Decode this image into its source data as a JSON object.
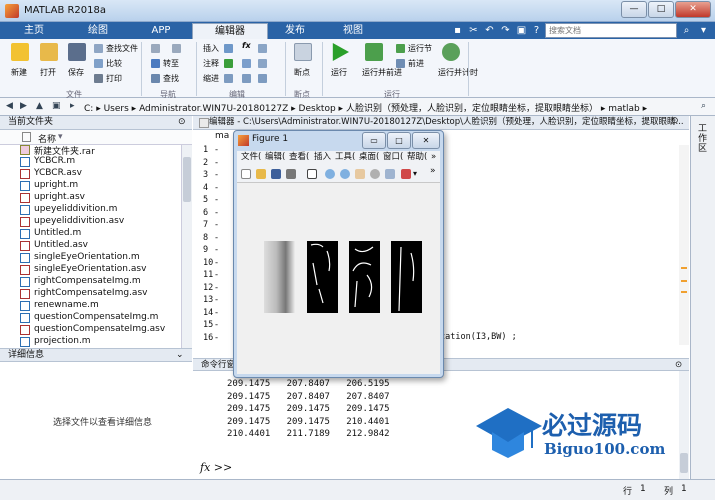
{
  "window": {
    "title": "MATLAB R2018a",
    "min": "—",
    "max": "□",
    "close": "✕"
  },
  "tabs": [
    {
      "label": "主页"
    },
    {
      "label": "绘图"
    },
    {
      "label": "APP"
    },
    {
      "label": "编辑器"
    },
    {
      "label": "发布"
    },
    {
      "label": "视图"
    }
  ],
  "search": {
    "placeholder": "搜索文档"
  },
  "ribbon": {
    "file": {
      "new": "新建",
      "open": "打开",
      "save": "保存",
      "find_files": "查找文件",
      "compare": "比较",
      "print": "打印",
      "group": "文件"
    },
    "navigate": {
      "goto": "转至",
      "find": "查找",
      "group": "导航"
    },
    "edit": {
      "insert": "插入",
      "comment": "注释",
      "indent": "缩进",
      "group": "编辑"
    },
    "breakpoint": {
      "label": "断点",
      "group": "断点"
    },
    "run": {
      "run": "运行",
      "run_advance": "运行并前进",
      "run_section": "运行节",
      "advance": "前进",
      "run_time": "运行并计时",
      "group": "运行"
    }
  },
  "address": {
    "segments": [
      "C:",
      "Users",
      "Administrator.WIN7U-20180127Z",
      "Desktop",
      "人脸识别（预处理，人脸识别，定位眼睛坐标，提取眼睛坐标）",
      "matlab"
    ]
  },
  "current_folder": {
    "title": "当前文件夹",
    "col_name": "名称",
    "files": [
      {
        "name": "新建文件夹.rar",
        "type": "rar"
      },
      {
        "name": "YCBCR.m",
        "type": "m"
      },
      {
        "name": "YCBCR.asv",
        "type": "asv"
      },
      {
        "name": "upright.m",
        "type": "m"
      },
      {
        "name": "upright.asv",
        "type": "asv"
      },
      {
        "name": "upeyeliddivition.m",
        "type": "m"
      },
      {
        "name": "upeyeliddivition.asv",
        "type": "asv"
      },
      {
        "name": "Untitled.m",
        "type": "m"
      },
      {
        "name": "Untitled.asv",
        "type": "asv"
      },
      {
        "name": "singleEyeOrientation.m",
        "type": "m"
      },
      {
        "name": "singleEyeOrientation.asv",
        "type": "asv"
      },
      {
        "name": "rightCompensateImg.m",
        "type": "m"
      },
      {
        "name": "rightCompensateImg.asv",
        "type": "asv"
      },
      {
        "name": "renewname.m",
        "type": "m"
      },
      {
        "name": "questionCompensateImg.m",
        "type": "m"
      },
      {
        "name": "questionCompensateImg.asv",
        "type": "asv"
      },
      {
        "name": "projection.m",
        "type": "m"
      }
    ]
  },
  "details": {
    "title": "详细信息",
    "message": "选择文件以查看详细信息"
  },
  "editor": {
    "title": "编辑器 - C:\\Users\\Administrator.WIN7U-20180127Z\\Desktop\\人脸识别（预处理，人脸识别，定位眼睛坐标，提取眼睛...",
    "tab_label": "ma",
    "lines": [
      "1",
      "2",
      "3",
      "4",
      "5",
      "6",
      "7",
      "8",
      "9",
      "10",
      "11",
      "12",
      "13",
      "14",
      "15",
      "16"
    ],
    "code_fragment": "cation(I3,BW) ;"
  },
  "command": {
    "title": "命令行窗口",
    "rows": [
      "209.1475   207.8407   206.5195",
      "209.1475   207.8407   207.8407",
      "209.1475   209.1475   209.1475",
      "209.1475   209.1475   210.4401",
      "210.4401   211.7189   212.9842"
    ],
    "prompt": "fx >>"
  },
  "workspace": {
    "label": "工作区"
  },
  "status": {
    "row_label": "行",
    "row": "1",
    "col_label": "列",
    "col": "1"
  },
  "figure": {
    "title": "Figure 1",
    "menu": [
      "文件(",
      "编辑(",
      "查看(",
      "插入",
      "工具(",
      "桌面(",
      "窗口(",
      "帮助("
    ],
    "min": "▭",
    "max": "□",
    "close": "✕"
  },
  "watermark": {
    "brand_cn": "必过源码",
    "brand_en": "Biguo100.com"
  },
  "colors": {
    "titlebar": "#c8dcf2",
    "tabbar": "#2a63a6",
    "accent": "#2c6fb3",
    "run_green": "#2aa02a",
    "close": "#c0392b"
  }
}
